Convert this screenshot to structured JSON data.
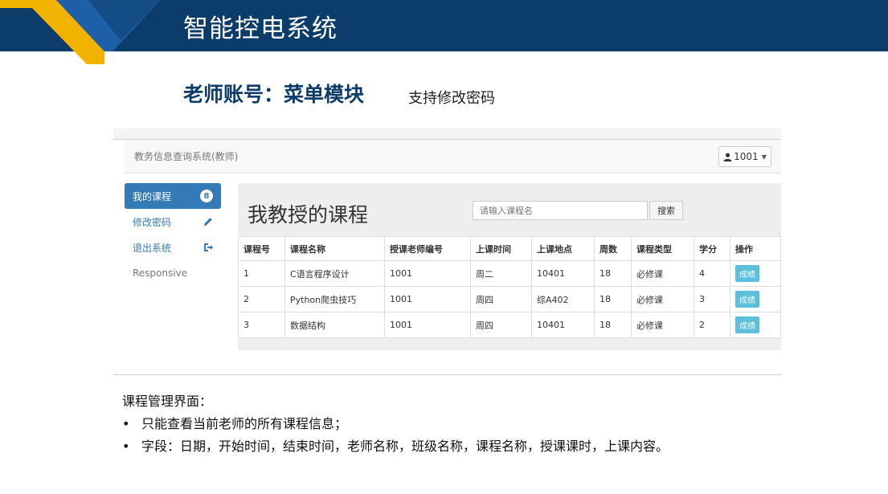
{
  "slide": {
    "title": "智能控电系统",
    "subtitle": "老师账号：菜单模块",
    "subtitle_note": "支持修改密码"
  },
  "app": {
    "brand": "教务信息查询系统(教师)",
    "user": "1001",
    "sidebar": [
      {
        "label": "我的课程",
        "badge": "8",
        "active": true
      },
      {
        "label": "修改密码",
        "icon": "pencil-icon"
      },
      {
        "label": "退出系统",
        "icon": "logout-icon"
      },
      {
        "label": "Responsive"
      }
    ],
    "heading": "我教授的课程",
    "search": {
      "placeholder": "请输入课程名",
      "button": "搜索"
    },
    "table": {
      "columns": [
        "课程号",
        "课程名称",
        "授课老师编号",
        "上课时间",
        "上课地点",
        "周数",
        "课程类型",
        "学分",
        "操作"
      ],
      "rows": [
        [
          "1",
          "C语言程序设计",
          "1001",
          "周二",
          "10401",
          "18",
          "必修课",
          "4",
          "成绩"
        ],
        [
          "2",
          "Python爬虫技巧",
          "1001",
          "周四",
          "综A402",
          "18",
          "必修课",
          "3",
          "成绩"
        ],
        [
          "3",
          "数据结构",
          "1001",
          "周四",
          "10401",
          "18",
          "必修课",
          "2",
          "成绩"
        ]
      ]
    }
  },
  "notes": {
    "title": "课程管理界面：",
    "bullets": [
      "只能查看当前老师的所有课程信息；",
      "字段：日期，开始时间，结束时间，老师名称，班级名称，课程名称，授课课时，上课内容。"
    ]
  },
  "colors": {
    "header": "#0c3c6a",
    "accent_yellow": "#f2b200",
    "accent_blue": "#1d5fa8",
    "primary": "#337ab7",
    "info": "#5bc0de"
  }
}
